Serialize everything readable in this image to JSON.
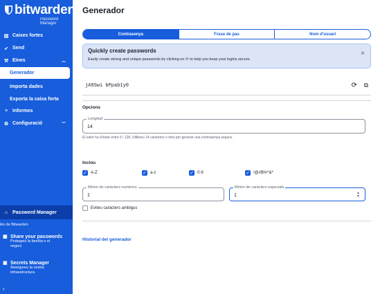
{
  "brand": {
    "name": "bitwarden",
    "subtitle": "Password Manager",
    "color": "#175ddc"
  },
  "sidebar": {
    "items": [
      {
        "label": "Caixes fortes",
        "icon": "vault-icon",
        "glyph": "▤"
      },
      {
        "label": "Send",
        "icon": "send-icon",
        "glyph": "➶"
      },
      {
        "label": "Eines",
        "icon": "tools-icon",
        "glyph": "⚒"
      },
      {
        "label": "Generador",
        "icon": "",
        "glyph": ""
      },
      {
        "label": "Importa dades",
        "icon": "",
        "glyph": ""
      },
      {
        "label": "Exporta la caixa forta",
        "icon": "",
        "glyph": ""
      },
      {
        "label": "Informes",
        "icon": "reports-icon",
        "glyph": "≡"
      },
      {
        "label": "Configuració",
        "icon": "settings-icon",
        "glyph": "⚙"
      }
    ],
    "product_switcher": {
      "label": "Password Manager"
    },
    "more_label": "lés de Bitwarden",
    "promos": [
      {
        "title": "Share your passwords",
        "desc1": "Protegeix la família o el",
        "desc2": "negoci"
      },
      {
        "title": "Secrets Manager",
        "desc1": "Assegureu la vostra",
        "desc2": "infraestructura"
      }
    ],
    "collapse_glyph": "‹"
  },
  "main": {
    "title": "Generador",
    "tabs": [
      {
        "label": "Contrasenya",
        "active": true
      },
      {
        "label": "Frase de pas",
        "active": false
      },
      {
        "label": "Nom d'usuari",
        "active": false
      }
    ],
    "callout": {
      "title": "Quickly create passwords",
      "desc": "Easily create strong and unique passwords by clicking on ⟳ to help you keep your logins secure.",
      "close": "×"
    },
    "password": "jA9Swi bPpab1y0",
    "options_label": "Opcions",
    "length": {
      "label": "Longitud",
      "value": "14",
      "hint": "El valor ha d'estar entre 5 i 128. Utilitzeu 14 caràcters o més per generar una contrasenya segura."
    },
    "include_label": "Inclou",
    "checkboxes": [
      {
        "label": "A-Z",
        "checked": true
      },
      {
        "label": "a-z",
        "checked": true
      },
      {
        "label": "0-9",
        "checked": true
      },
      {
        "label": "!@#$%^&*",
        "checked": true
      }
    ],
    "min_numbers": {
      "label": "Mínim de caràcters numèrics",
      "value": "1"
    },
    "min_special": {
      "label": "Mínim de caràcters especials",
      "value": "1"
    },
    "avoid_ambiguous": {
      "label": "Eviteu caràcters ambigus",
      "checked": false
    },
    "history_link": "Historial del generador"
  }
}
